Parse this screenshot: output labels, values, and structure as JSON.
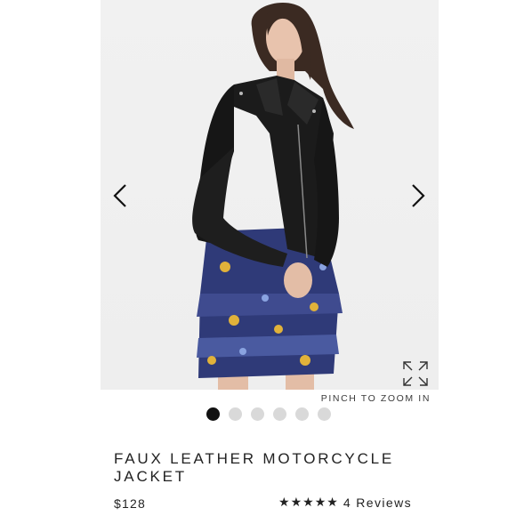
{
  "product": {
    "image_alt": "Model wearing faux leather motorcycle jacket over floral tiered dress",
    "zoom_hint": "PINCH TO ZOOM IN",
    "title": "FAUX LEATHER MOTORCYCLE JACKET",
    "price": "$128",
    "rating": {
      "stars": 5,
      "reviews_label": "4 Reviews"
    }
  },
  "carousel": {
    "slide_count": 6,
    "active_index": 0
  },
  "icons": {
    "prev": "chevron-left-icon",
    "next": "chevron-right-icon",
    "zoom": "expand-icon",
    "star": "star-icon"
  },
  "colors": {
    "active_dot": "#111111",
    "inactive_dot": "#d9d9d9",
    "text": "#222222"
  }
}
